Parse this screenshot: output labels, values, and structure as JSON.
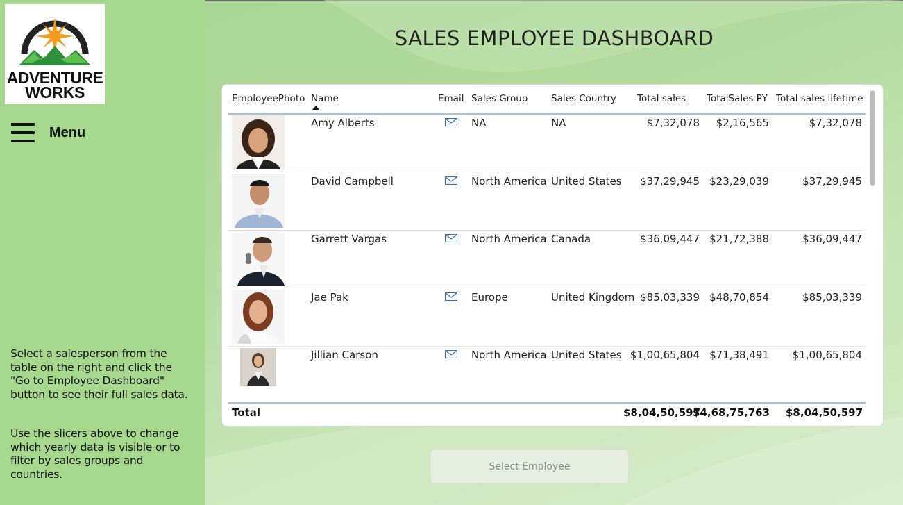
{
  "brand": {
    "line1": "ADVENTURE",
    "line2": "WORKS"
  },
  "menu": {
    "label": "Menu"
  },
  "help": {
    "p1": "Select a salesperson from the table on the right and click the \"Go to Employee Dashboard\" button to see their full sales data.",
    "p2": "Use the slicers above to change which yearly data is visible or to filter by sales groups and countries."
  },
  "page": {
    "title": "SALES EMPLOYEE DASHBOARD"
  },
  "table": {
    "columns": {
      "photo": "EmployeePhoto",
      "name": "Name",
      "email": "Email",
      "group": "Sales Group",
      "country": "Sales Country",
      "total": "Total sales",
      "py": "TotalSales PY",
      "lifetime": "Total sales lifetime"
    },
    "sorted_by": "Name",
    "rows": [
      {
        "name": "Amy Alberts",
        "group": "NA",
        "country": "NA",
        "total": "$7,32,078",
        "py": "$2,16,565",
        "lifetime": "$7,32,078"
      },
      {
        "name": "David Campbell",
        "group": "North America",
        "country": "United States",
        "total": "$37,29,945",
        "py": "$23,29,039",
        "lifetime": "$37,29,945"
      },
      {
        "name": "Garrett Vargas",
        "group": "North America",
        "country": "Canada",
        "total": "$36,09,447",
        "py": "$21,72,388",
        "lifetime": "$36,09,447"
      },
      {
        "name": "Jae Pak",
        "group": "Europe",
        "country": "United Kingdom",
        "total": "$85,03,339",
        "py": "$48,70,854",
        "lifetime": "$85,03,339"
      },
      {
        "name": "Jillian Carson",
        "group": "North America",
        "country": "United States",
        "total": "$1,00,65,804",
        "py": "$71,38,491",
        "lifetime": "$1,00,65,804"
      }
    ],
    "totals": {
      "label": "Total",
      "total": "$8,04,50,597",
      "py": "$4,68,75,763",
      "lifetime": "$8,04,50,597"
    }
  },
  "button": {
    "label": "Select Employee"
  },
  "icons": {
    "menu": "hamburger-icon",
    "email": "mail-icon",
    "sort": "sort-ascending-icon"
  },
  "colors": {
    "sidebar": "#a5d88d",
    "header_line": "#9fc3e0",
    "logo_orange": "#f39c1f",
    "logo_green": "#2f8f3a"
  }
}
